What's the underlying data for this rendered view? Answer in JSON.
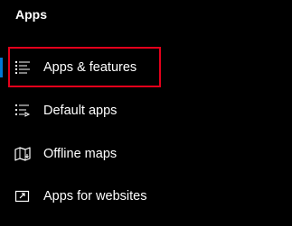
{
  "section": {
    "title": "Apps"
  },
  "nav": {
    "items": [
      {
        "label": "Apps & features",
        "icon": "apps-features-icon",
        "selected": true
      },
      {
        "label": "Default apps",
        "icon": "default-apps-icon",
        "selected": false
      },
      {
        "label": "Offline maps",
        "icon": "offline-maps-icon",
        "selected": false
      },
      {
        "label": "Apps for websites",
        "icon": "apps-for-websites-icon",
        "selected": false
      }
    ]
  },
  "colors": {
    "background": "#000000",
    "text": "#ffffff",
    "accent": "#0078d4",
    "highlight": "#e3001b"
  }
}
